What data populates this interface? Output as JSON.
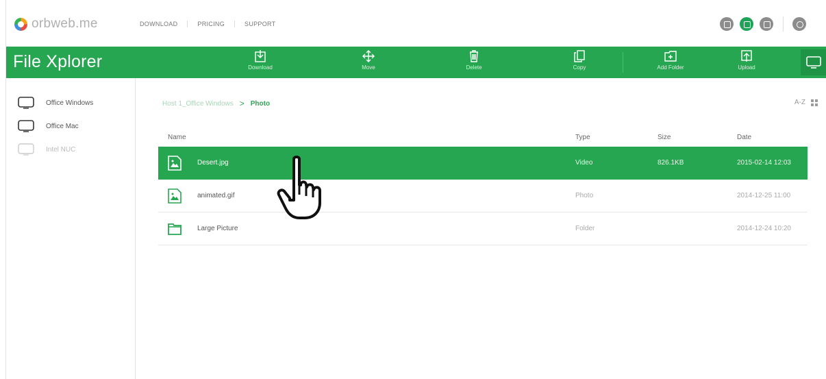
{
  "brand": {
    "logo_text": "orbweb.me"
  },
  "topnav": {
    "items": [
      "DOWNLOAD",
      "PRICING",
      "SUPPORT"
    ]
  },
  "top_icons": [
    "chat-icon",
    "folder-icon",
    "settings-icon",
    "user-icon"
  ],
  "app": {
    "title": "File Xplorer"
  },
  "toolbar": {
    "download": "Download",
    "move": "Move",
    "delete": "Delete",
    "copy": "Copy",
    "add_folder": "Add Folder",
    "upload": "Upload"
  },
  "sidebar": {
    "devices": [
      {
        "label": "Office Windows",
        "online": true
      },
      {
        "label": "Office Mac",
        "online": true
      },
      {
        "label": "Intel NUC",
        "online": false
      }
    ]
  },
  "breadcrumb": {
    "host": "Host 1_Office Windows",
    "separator": ">",
    "current": "Photo"
  },
  "sort": {
    "label": "A-Z"
  },
  "table": {
    "headers": {
      "name": "Name",
      "type": "Type",
      "size": "Size",
      "date": "Date"
    },
    "rows": [
      {
        "name": "Desert.jpg",
        "type": "Video",
        "size": "826.1KB",
        "date": "2015-02-14 12:03",
        "icon": "image-file-icon",
        "selected": true
      },
      {
        "name": "animated.gif",
        "type": "Photo",
        "size": "",
        "date": "2014-12-25 11:00",
        "icon": "image-file-icon",
        "selected": false
      },
      {
        "name": "Large Picture",
        "type": "Folder",
        "size": "",
        "date": "2014-12-24 10:20",
        "icon": "folder-icon",
        "selected": false
      }
    ]
  },
  "colors": {
    "accent": "#27a651",
    "accent_dark": "#1f9446"
  }
}
